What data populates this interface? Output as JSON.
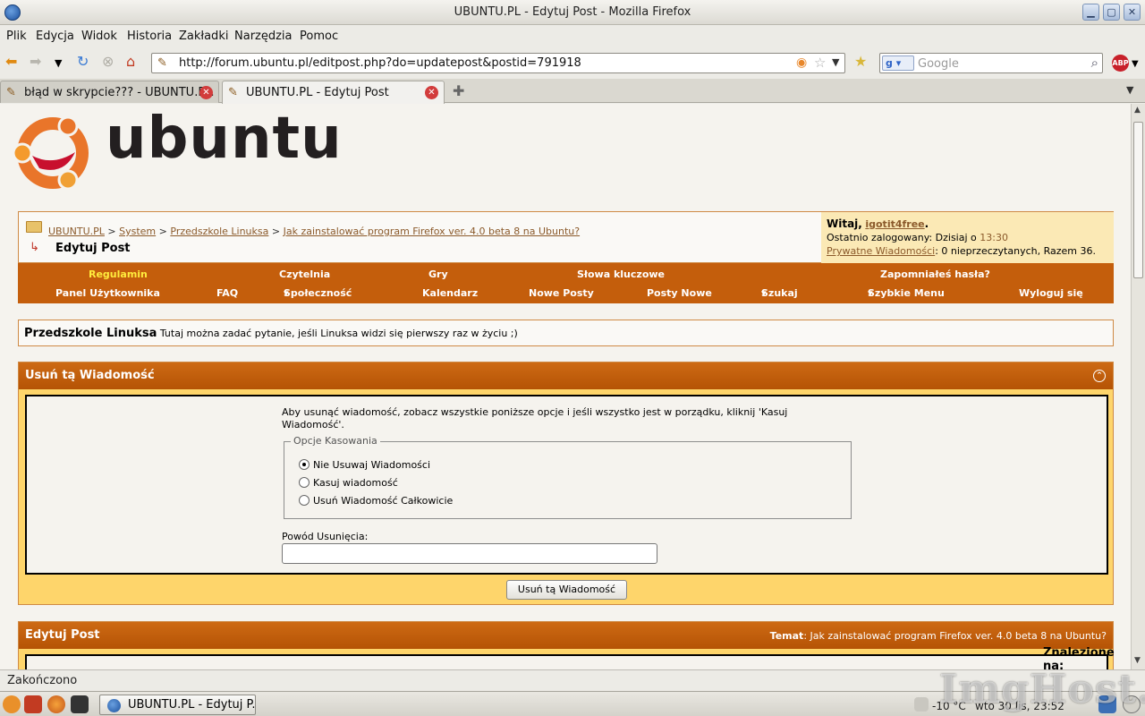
{
  "window": {
    "title": "UBUNTU.PL - Edytuj Post - Mozilla Firefox"
  },
  "menu": [
    "Plik",
    "Edycja",
    "Widok",
    "Historia",
    "Zakładki",
    "Narzędzia",
    "Pomoc"
  ],
  "address": {
    "url": "http://forum.ubuntu.pl/editpost.php?do=updatepost&postid=791918"
  },
  "search": {
    "placeholder": "Google"
  },
  "tabs": [
    {
      "label": "błąd w skrypcie??? - UBUNTU.P..."
    },
    {
      "label": "UBUNTU.PL - Edytuj Post"
    }
  ],
  "logo": {
    "text": "ubuntu"
  },
  "breadcrumb": {
    "items": [
      "UBUNTU.PL",
      "System",
      "Przedszkole Linuksa",
      "Jak zainstalować program Firefox ver. 4.0 beta 8 na Ubuntu?"
    ],
    "current": "Edytuj Post"
  },
  "welcome": {
    "greeting": "Witaj,",
    "username": "igotit4free",
    "last_login_label": "Ostatnio zalogowany: Dzisiaj o",
    "last_login_time": "13:30",
    "pm_label": "Prywatne Wiadomości",
    "pm_stats": ": 0 nieprzeczytanych, Razem 36."
  },
  "navmenu": {
    "row1": [
      "Regulamin",
      "Czytelnia",
      "Gry",
      "Słowa kluczowe",
      "Zapomniałeś hasła?"
    ],
    "row2": [
      "Panel Użytkownika",
      "FAQ",
      "Społeczność",
      "Kalendarz",
      "Nowe Posty",
      "Posty Nowe",
      "Szukaj",
      "Szybkie Menu",
      "Wyloguj się"
    ]
  },
  "forum": {
    "name": "Przedszkole Linuksa",
    "description": "Tutaj można zadać pytanie, jeśli Linuksa widzi się pierwszy raz w życiu ;)"
  },
  "delete_panel": {
    "title": "Usuń tą Wiadomość",
    "instructions": "Aby usunąć wiadomość, zobacz wszystkie poniższe opcje i jeśli wszystko jest w porządku, kliknij 'Kasuj Wiadomość'.",
    "options_legend": "Opcje Kasowania",
    "options": [
      {
        "label": "Nie Usuwaj Wiadomości",
        "checked": true
      },
      {
        "label": "Kasuj wiadomość",
        "checked": false
      },
      {
        "label": "Usuń Wiadomość Całkowicie",
        "checked": false
      }
    ],
    "reason_label": "Powód Usunięcia:",
    "reason_value": "",
    "submit_label": "Usuń tą Wiadomość"
  },
  "edit_panel": {
    "title": "Edytuj Post",
    "topic_label": "Temat",
    "topic_value": ": Jak zainstalować program Firefox ver. 4.0 beta 8 na Ubuntu?"
  },
  "overlay": {
    "found_label": "Znalezione na:"
  },
  "status": {
    "text": "Zakończono"
  },
  "taskbar": {
    "task_label": "UBUNTU.PL - Edytuj P...",
    "temperature": "-10 °C",
    "clock": "wto 30 lis, 23:52"
  },
  "watermark": "ImgHost.pl",
  "colors": {
    "accent_orange": "#c45e0c",
    "panel_yellow": "#fed56b",
    "link_brown": "#8b5a2b",
    "welcome_bg": "#fbe9b5"
  }
}
